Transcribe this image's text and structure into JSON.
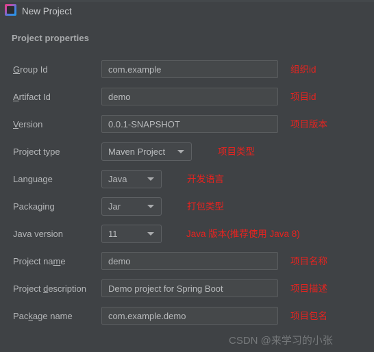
{
  "window": {
    "title": "New Project",
    "icon": "intellij-idea-icon"
  },
  "section": {
    "header": "Project properties"
  },
  "fields": [
    {
      "label_pre": "",
      "label_mnemonic": "G",
      "label_post": "roup Id",
      "label_full": "Group Id",
      "control": "text",
      "value": "com.example",
      "note": "组织id"
    },
    {
      "label_pre": "",
      "label_mnemonic": "A",
      "label_post": "rtifact Id",
      "label_full": "Artifact Id",
      "control": "text",
      "value": "demo",
      "note": "项目id"
    },
    {
      "label_pre": "",
      "label_mnemonic": "V",
      "label_post": "ersion",
      "label_full": "Version",
      "control": "text",
      "value": "0.0.1-SNAPSHOT",
      "note": "项目版本"
    },
    {
      "label_pre": "Project type",
      "label_mnemonic": "",
      "label_post": "",
      "label_full": "Project type",
      "control": "combo",
      "value": "Maven Project",
      "note": "项目类型"
    },
    {
      "label_pre": "Language",
      "label_mnemonic": "",
      "label_post": "",
      "label_full": "Language",
      "control": "combo-small",
      "value": "Java",
      "note": "开发语言"
    },
    {
      "label_pre": "Packaging",
      "label_mnemonic": "",
      "label_post": "",
      "label_full": "Packaging",
      "control": "combo-small",
      "value": "Jar",
      "note": "打包类型"
    },
    {
      "label_pre": "Java version",
      "label_mnemonic": "",
      "label_post": "",
      "label_full": "Java version",
      "control": "combo-small",
      "value": "11",
      "note": "Java 版本(推荐使用 Java 8)"
    },
    {
      "label_pre": "Project na",
      "label_mnemonic": "m",
      "label_post": "e",
      "label_full": "Project name",
      "control": "text",
      "value": "demo",
      "note": "项目名称"
    },
    {
      "label_pre": "Project ",
      "label_mnemonic": "d",
      "label_post": "escription",
      "label_full": "Project description",
      "control": "text",
      "value": "Demo project for Spring Boot",
      "note": "项目描述"
    },
    {
      "label_pre": "Pac",
      "label_mnemonic": "k",
      "label_post": "age name",
      "label_full": "Package name",
      "control": "text",
      "value": "com.example.demo",
      "note": "项目包名"
    }
  ],
  "watermark": "CSDN @来学习的小张",
  "colors": {
    "background": "#3f4245",
    "field_background": "#45484a",
    "field_border": "#5a5d5f",
    "text": "#b4b6b8",
    "annotation_red": "#e8231f",
    "watermark": "#76797b"
  }
}
